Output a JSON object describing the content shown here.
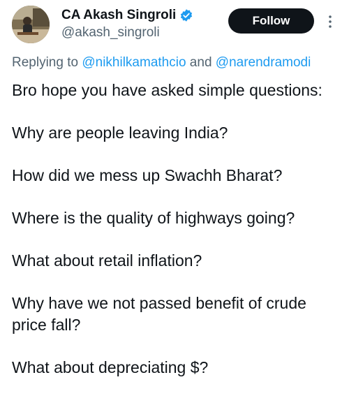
{
  "author": {
    "display_name": "CA Akash Singroli",
    "handle": "@akash_singroli",
    "verified": true,
    "verified_color": "#1d9bf0"
  },
  "actions": {
    "follow_label": "Follow",
    "more_icon": "more-vertical-icon"
  },
  "reply_context": {
    "prefix": "Replying to ",
    "mention_1": "@nikhilkamathcio",
    "connector": " and ",
    "mention_2": "@narendramodi"
  },
  "tweet": {
    "paragraphs": [
      "Bro hope you have asked simple questions:",
      "Why are people leaving India?",
      "How did we mess up Swachh Bharat?",
      "Where is the quality of highways going?",
      "What about retail inflation?",
      "Why have we not passed benefit of crude price fall?",
      "What about depreciating $?"
    ]
  },
  "colors": {
    "text_primary": "#0f1419",
    "text_secondary": "#536471",
    "link": "#1d9bf0",
    "follow_bg": "#0f1419"
  }
}
